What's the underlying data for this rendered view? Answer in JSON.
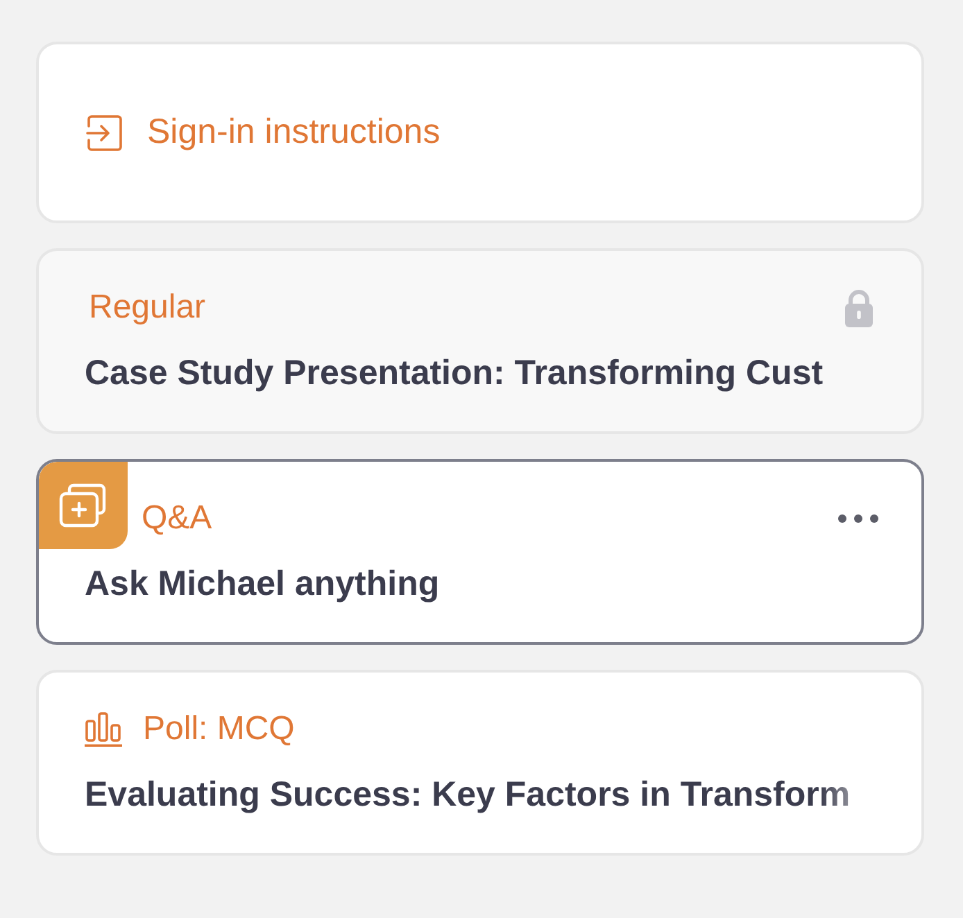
{
  "cards": [
    {
      "kind": "link",
      "label": "Sign-in instructions"
    },
    {
      "kind": "regular",
      "type_label": "Regular",
      "title": "Case Study Presentation: Transforming Cust",
      "locked": true,
      "selected": false
    },
    {
      "kind": "qa",
      "type_label": "Q&A",
      "title": "Ask Michael anything",
      "locked": false,
      "selected": true
    },
    {
      "kind": "poll",
      "type_label": "Poll: MCQ",
      "title": "Evaluating Success: Key Factors in Transform",
      "locked": false,
      "selected": false
    }
  ]
}
